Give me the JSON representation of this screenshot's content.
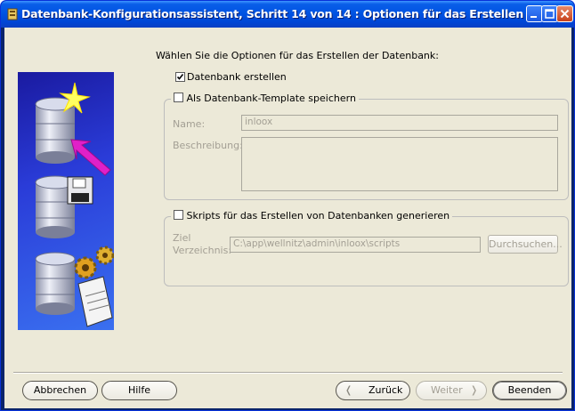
{
  "window": {
    "title": "Datenbank-Konfigurationsassistent, Schritt 14 von 14 : Optionen für das Erstellen"
  },
  "main": {
    "intro": "Wählen Sie die Optionen für das Erstellen der Datenbank:",
    "create_db": {
      "label": "Datenbank erstellen",
      "checked": true
    },
    "template_group": {
      "label": "Als Datenbank-Template speichern",
      "checked": false,
      "name_label": "Name:",
      "name_value": "inloox",
      "desc_label": "Beschreibung:",
      "desc_value": ""
    },
    "scripts_group": {
      "label": "Skripts für das Erstellen von Datenbanken generieren",
      "checked": false,
      "target_label_1": "Ziel",
      "target_label_2": "Verzeichnis:",
      "target_value": "C:\\app\\wellnitz\\admin\\inloox\\scripts",
      "browse_label": "Durchsuchen..."
    }
  },
  "footer": {
    "cancel": "Abbrechen",
    "help": "Hilfe",
    "back": "Zurück",
    "next": "Weiter",
    "finish": "Beenden"
  },
  "colors": {
    "titlebar": "#0054e3",
    "client_bg": "#ece9d8",
    "accent_arrow": "#e020c8"
  }
}
